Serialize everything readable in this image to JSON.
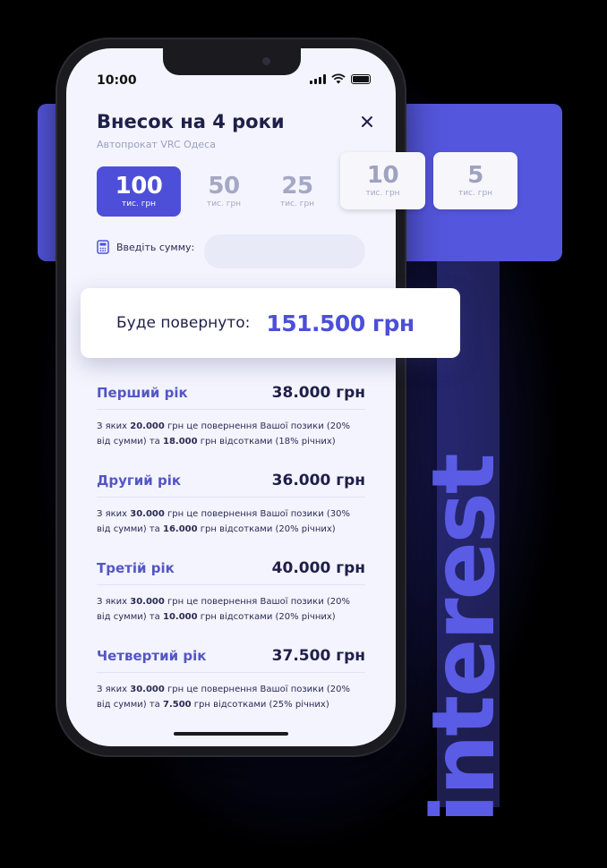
{
  "status": {
    "time": "10:00"
  },
  "modal": {
    "title": "Внесок на 4 роки",
    "subtitle": "Автопрокат VRC Одеса"
  },
  "amount_options": [
    {
      "value": "100",
      "unit": "тис. грн",
      "selected": true
    },
    {
      "value": "50",
      "unit": "тис. грн"
    },
    {
      "value": "25",
      "unit": "тис. грн"
    },
    {
      "value": "10",
      "unit": "тис. грн"
    },
    {
      "value": "5",
      "unit": "тис. грн"
    }
  ],
  "sum_input": {
    "label": "Введіть сумму:",
    "value": ""
  },
  "returned": {
    "label": "Буде повернуто:",
    "value": "151.500 грн"
  },
  "years": [
    {
      "name": "Перший рік",
      "amount": "38.000 грн",
      "desc": [
        "З яких ",
        "20.000",
        " грн це повернення Вашої позики (20% від сумми) та ",
        "18.000",
        "  грн відсотками (18% річних)"
      ]
    },
    {
      "name": "Другий рік",
      "amount": "36.000 грн",
      "desc": [
        "З яких ",
        "30.000",
        " грн це повернення Вашої позики (30% від сумми) та ",
        "16.000",
        "  грн відсотками (20% річних)"
      ]
    },
    {
      "name": "Третій рік",
      "amount": "40.000 грн",
      "desc": [
        "З яких ",
        "30.000",
        " грн це повернення Вашої позики (20% від сумми) та ",
        "10.000",
        "  грн відсотками (20% річних)"
      ]
    },
    {
      "name": "Четвертий рік",
      "amount": "37.500 грн",
      "desc": [
        "З яких ",
        "30.000",
        " грн це повернення Вашої позики (20% від сумми) та ",
        "7.500",
        "  грн відсотками (25% річних)"
      ]
    }
  ],
  "decor": {
    "vertical_word": "interest"
  },
  "colors": {
    "accent": "#4d4fd8",
    "panel": "#5456dd",
    "heading": "#1f1f4a"
  }
}
